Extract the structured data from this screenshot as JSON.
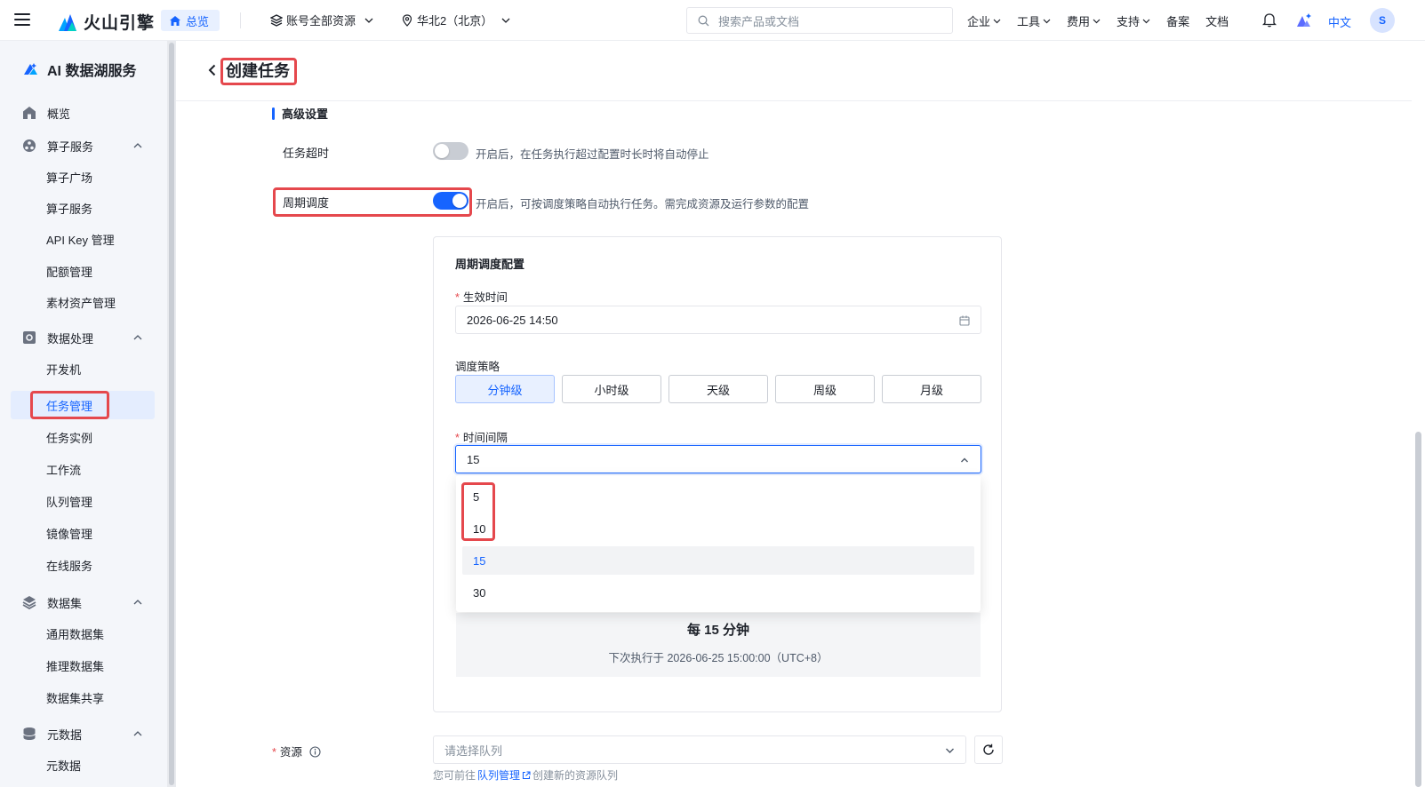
{
  "topnav": {
    "brand": "火山引擎",
    "home_label": "总览",
    "account_scope": "账号全部资源",
    "region": "华北2（北京）",
    "search_placeholder": "搜索产品或文档",
    "links": [
      {
        "label": "企业",
        "has_menu": true
      },
      {
        "label": "工具",
        "has_menu": true
      },
      {
        "label": "费用",
        "has_menu": true
      },
      {
        "label": "支持",
        "has_menu": true
      },
      {
        "label": "备案",
        "has_menu": false
      },
      {
        "label": "文档",
        "has_menu": false
      }
    ],
    "language": "中文",
    "avatar_initial": "S",
    "accent_color": "#1664ff"
  },
  "sidebar": {
    "product_name": "AI 数据湖服务",
    "items": {
      "overview": "概览",
      "operator_service_group": "算子服务",
      "operator_plaza": "算子广场",
      "operator_service": "算子服务",
      "api_key": "API Key 管理",
      "quota": "配额管理",
      "asset": "素材资产管理",
      "data_processing_group": "数据处理",
      "dev_machine": "开发机",
      "task_mgmt": "任务管理",
      "task_instance": "任务实例",
      "workflow": "工作流",
      "queue_mgmt": "队列管理",
      "image_mgmt": "镜像管理",
      "online_service": "在线服务",
      "dataset_group": "数据集",
      "general_dataset": "通用数据集",
      "inference_dataset": "推理数据集",
      "dataset_share": "数据集共享",
      "metadata_group": "元数据",
      "metadata": "元数据"
    },
    "active_item": "task_mgmt"
  },
  "header": {
    "title": "创建任务"
  },
  "advanced": {
    "section_title": "高级设置",
    "timeout_label": "任务超时",
    "timeout_enabled": false,
    "timeout_hint": "开启后，在任务执行超过配置时长时将自动停止",
    "schedule_label": "周期调度",
    "schedule_enabled": true,
    "schedule_hint": "开启后，可按调度策略自动执行任务。需完成资源及运行参数的配置"
  },
  "schedule_config": {
    "title": "周期调度配置",
    "effective_time_label": "生效时间",
    "effective_time_value": "2026-06-25 14:50",
    "strategy_label": "调度策略",
    "strategy_options": [
      "分钟级",
      "小时级",
      "天级",
      "周级",
      "月级"
    ],
    "strategy_selected": "分钟级",
    "interval_label": "时间间隔",
    "interval_value": "15",
    "interval_options": [
      "5",
      "10",
      "15",
      "30"
    ],
    "interval_selected": "15",
    "preview_main": "每 15 分钟",
    "preview_sub": "下次执行于 2026-06-25 15:00:00（UTC+8）"
  },
  "resource": {
    "label": "资源",
    "placeholder": "请选择队列",
    "help_prefix": "您可前往",
    "help_link": "队列管理",
    "help_suffix": "创建新的资源队列"
  }
}
